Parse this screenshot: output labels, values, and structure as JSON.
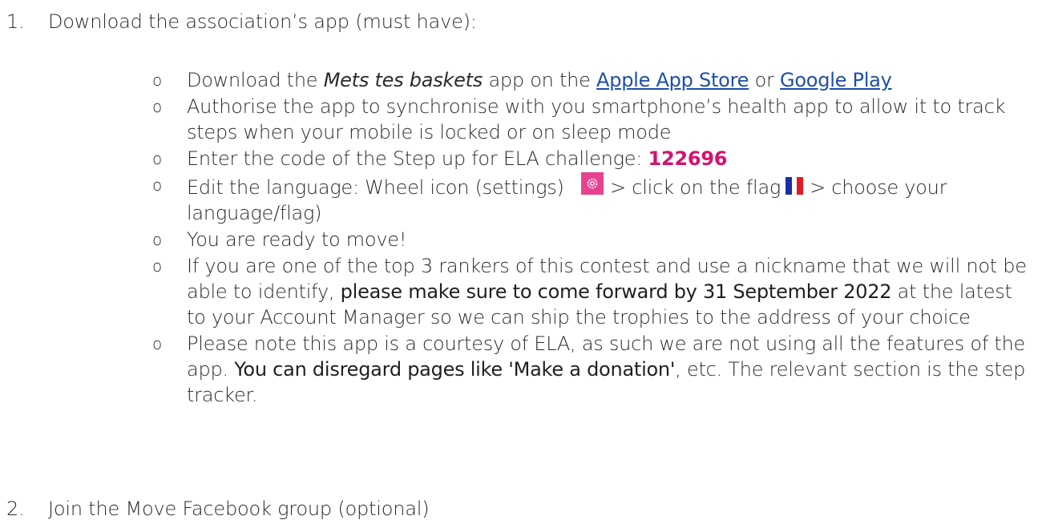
{
  "steps": [
    {
      "number": "1.",
      "text": "Download the association’s app (must have):"
    },
    {
      "number": "2.",
      "text": "Join the Move Facebook group (optional)"
    }
  ],
  "bullet_glyph": "o",
  "items": {
    "download": {
      "prefix": "Download the ",
      "app_name": "Mets tes baskets",
      "middle": " app on the ",
      "link_apple": "Apple App Store",
      "or": " or ",
      "link_google": "Google Play"
    },
    "authorise": {
      "text": "Authorise the app to synchronise with you smartphone’s health app to allow it to track steps when your mobile is locked or on sleep mode"
    },
    "code": {
      "prefix": "Enter the code of the Step up for ELA challenge: ",
      "value": "122696"
    },
    "language": {
      "prefix": "Edit the language: Wheel icon (settings) ",
      "middle": "> click on the flag",
      "suffix": "> choose your language/flag)"
    },
    "ready": {
      "text": "You are ready to move!"
    },
    "top3": {
      "prefix": "If you are one of the top 3 rankers of this contest and use a nickname that we will not be able to identify, ",
      "bold": "please make sure to come forward by 31 September 2022",
      "suffix": " at the latest to your Account Manager so we can ship the trophies to the address of your choice"
    },
    "note": {
      "prefix": "Please note this app is a courtesy of ELA, as such we are not using all the features of the app. ",
      "bold": "You can disregard pages like 'Make a donation'",
      "suffix": ", etc. The relevant section is the step tracker."
    }
  },
  "colors": {
    "link": "#1f4fa8",
    "code": "#d4136f",
    "settings_icon_bg": "#e8428f",
    "flag_blue": "#1a2fa6",
    "flag_red": "#e01b24"
  }
}
